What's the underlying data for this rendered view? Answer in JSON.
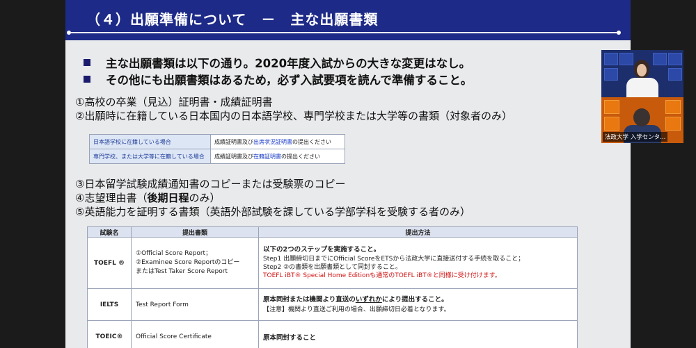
{
  "slide": {
    "title": "（４）出願準備について　－　主な出願書類",
    "bullets": [
      "主な出願書類は以下の通り。2020年度入試からの大きな変更はなし。",
      "その他にも出願書類はあるため，必ず入試要項を読んで準備すること。"
    ],
    "items": {
      "i1": "①高校の卒業（見込）証明書・成績証明書",
      "i2": "②出願時に在籍している日本国内の日本語学校、専門学校または大学等の書類（対象者のみ）",
      "i3": "③日本留学試験成績通知書のコピーまたは受験票のコピー",
      "i4a": "④志望理由書（",
      "i4b": "後期日程",
      "i4c": "のみ）",
      "i5": "⑤英語能力を証明する書類（英語外部試験を課している学部学科を受験する者のみ）"
    },
    "school_table": {
      "r1_label": "日本語学校に在籍している場合",
      "r1_a": "成績証明書及び",
      "r1_b": "出席状況証明書",
      "r1_c": "の提出ください",
      "r2_label": "専門学校、または大学等に在籍している場合",
      "r2_a": "成績証明書及び",
      "r2_b": "在籍証明書",
      "r2_c": "の提出ください"
    },
    "exam_table": {
      "h1": "試験名",
      "h2": "提出書類",
      "h3": "提出方法",
      "toefl": {
        "name": "TOEFL ®",
        "docs1": "①Official Score Report；",
        "docs2": "②Examinee Score Reportのコピー",
        "docs3": "またはTest Taker Score Report",
        "m1": "以下の2つのステップを実施すること。",
        "m2": "Step1 出願締切日までにOfficial ScoreをETSから法政大学に直接送付する手続を取ること；",
        "m3": "Step2 ②の書類を出願書類として同封すること。",
        "m4": "TOEFL iBT® Special Home Editionも通常のTOEFL iBT®と同様に受け付けます。"
      },
      "ielts": {
        "name": "IELTS",
        "docs": "Test Report Form",
        "m1a": "原本同封または機関より直送の",
        "m1b": "いずれか",
        "m1c": "により提出すること。",
        "m2": "【注意】機関より直送ご利用の場合、出願締切日必着となります。"
      },
      "toeic": {
        "name": "TOEIC®",
        "docs": "Official Score Certificate",
        "m1": "原本同封すること"
      }
    }
  },
  "video": {
    "caption": "法政大学 入学センタ..."
  },
  "colors": {
    "header_bg": "#1d2a87",
    "slide_bg": "#e9eaec",
    "accent_red": "#d01010",
    "link_blue": "#1a3cc9"
  }
}
